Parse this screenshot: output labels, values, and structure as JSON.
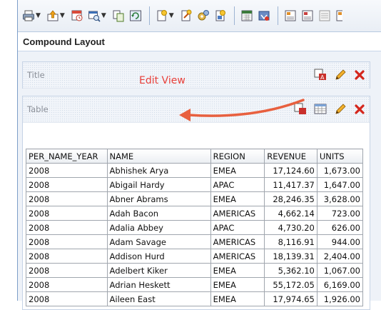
{
  "section": {
    "title": "Compound Layout"
  },
  "views": {
    "title_view": {
      "label": "Title"
    },
    "table_view": {
      "label": "Table"
    }
  },
  "annotation": {
    "text": "Edit View",
    "color": "#e8403a"
  },
  "toolbar": {
    "icons": [
      "print-icon",
      "export-icon",
      "schedule-icon",
      "preview-icon",
      "copy-icon",
      "refresh-icon",
      "new-view-icon",
      "edit-view-icon",
      "properties-icon",
      "filter-icon",
      "calculator-icon",
      "prompt-icon",
      "report-icon",
      "report-2-icon",
      "report-3-icon"
    ]
  },
  "table": {
    "columns": [
      "PER_NAME_YEAR",
      "NAME",
      "REGION",
      "REVENUE",
      "UNITS"
    ],
    "rows": [
      [
        "2008",
        "Abhishek Arya",
        "EMEA",
        "17,124.60",
        "1,673.00"
      ],
      [
        "2008",
        "Abigail Hardy",
        "APAC",
        "11,417.37",
        "1,647.00"
      ],
      [
        "2008",
        "Abner Abrams",
        "EMEA",
        "28,246.35",
        "3,628.00"
      ],
      [
        "2008",
        "Adah Bacon",
        "AMERICAS",
        "4,662.14",
        "723.00"
      ],
      [
        "2008",
        "Adalia Abbey",
        "APAC",
        "4,730.20",
        "626.00"
      ],
      [
        "2008",
        "Adam Savage",
        "AMERICAS",
        "8,116.91",
        "944.00"
      ],
      [
        "2008",
        "Addison Hurd",
        "AMERICAS",
        "18,139.31",
        "2,404.00"
      ],
      [
        "2008",
        "Adelbert Kiker",
        "EMEA",
        "5,362.10",
        "1,067.00"
      ],
      [
        "2008",
        "Adrian Heskett",
        "EMEA",
        "55,172.05",
        "6,169.00"
      ],
      [
        "2008",
        "Aileen East",
        "EMEA",
        "17,974.65",
        "1,926.00"
      ]
    ]
  }
}
